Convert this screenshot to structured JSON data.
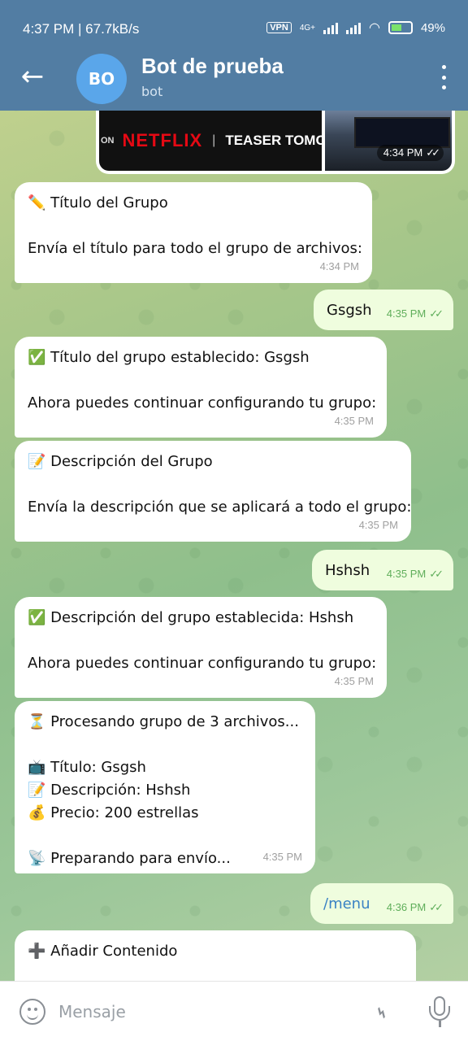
{
  "status_bar": {
    "time": "4:37 PM | 67.7kB/s",
    "vpn": "VPN",
    "network": "4G+",
    "battery": "49%"
  },
  "header": {
    "back_icon": "back-arrow-icon",
    "avatar_initials": "BO",
    "title": "Bot de prueba",
    "subtitle": "bot",
    "menu_icon": "more-vert-icon"
  },
  "media": {
    "thumb1_prefix": "ON",
    "thumb1_brand": "NETFLIX",
    "thumb1_sep": "|",
    "thumb1_text": "TEASER TOMORR",
    "time": "4:34 PM"
  },
  "messages": [
    {
      "dir": "in",
      "lines": [
        "✏️ Título del Grupo",
        "",
        "Envía el título para todo el grupo de archivos:"
      ],
      "time": "4:34 PM"
    },
    {
      "dir": "out",
      "lines": [
        "Gsgsh"
      ],
      "time": "4:35 PM"
    },
    {
      "dir": "in",
      "lines": [
        "✅ Título del grupo establecido: Gsgsh",
        "",
        "Ahora puedes continuar configurando tu grupo:"
      ],
      "time": "4:35 PM"
    },
    {
      "dir": "in",
      "lines": [
        "📝 Descripción del Grupo",
        "",
        "Envía la descripción que se aplicará a todo el grupo:"
      ],
      "time": "4:35 PM"
    },
    {
      "dir": "out",
      "lines": [
        "Hshsh"
      ],
      "time": "4:35 PM"
    },
    {
      "dir": "in",
      "lines": [
        "✅ Descripción del grupo establecida: Hshsh",
        "",
        "Ahora puedes continuar configurando tu grupo:"
      ],
      "time": "4:35 PM"
    },
    {
      "dir": "in",
      "lines": [
        "⏳ Procesando grupo de 3 archivos...",
        "",
        "📺 Título: Gsgsh",
        "📝 Descripción: Hshsh",
        "💰 Precio: 200 estrellas",
        "",
        "📡 Preparando para envío..."
      ],
      "time": "4:35 PM"
    },
    {
      "dir": "out",
      "lines": [
        "/menu"
      ],
      "time": "4:36 PM"
    },
    {
      "dir": "in",
      "lines": [
        "➕ Añadir Contenido"
      ],
      "time": ""
    }
  ],
  "composer": {
    "placeholder": "Mensaje",
    "emoji_icon": "emoji-icon",
    "attach_icon": "paperclip-icon",
    "mic_icon": "microphone-icon"
  }
}
